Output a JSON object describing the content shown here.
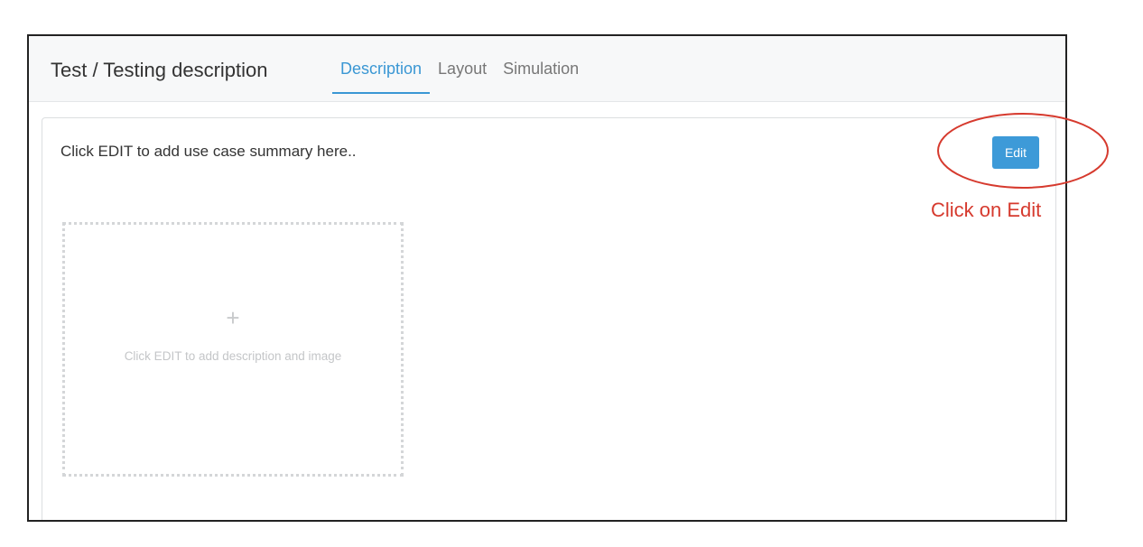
{
  "header": {
    "title": "Test / Testing description",
    "tabs": [
      {
        "label": "Description",
        "active": true
      },
      {
        "label": "Layout",
        "active": false
      },
      {
        "label": "Simulation",
        "active": false
      }
    ]
  },
  "panel": {
    "summary": "Click EDIT to add use case summary here..",
    "edit_label": "Edit",
    "dropzone": {
      "icon": "plus-icon",
      "plus_glyph": "+",
      "label": "Click EDIT to add description and image"
    }
  },
  "annotation": {
    "text": "Click on Edit",
    "color": "#d63a2e"
  },
  "colors": {
    "accent": "#3a97d4",
    "button": "#3d9ad8"
  }
}
